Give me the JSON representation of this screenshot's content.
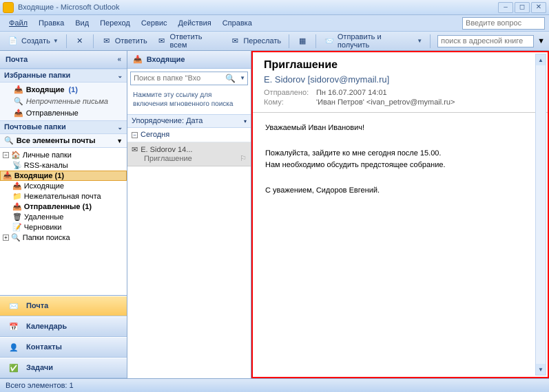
{
  "window": {
    "title": "Входящие - Microsoft Outlook"
  },
  "menu": {
    "file": "Файл",
    "edit": "Правка",
    "view": "Вид",
    "go": "Переход",
    "tools": "Сервис",
    "actions": "Действия",
    "help": "Справка",
    "question_placeholder": "Введите вопрос"
  },
  "toolbar": {
    "create": "Создать",
    "reply": "Ответить",
    "reply_all": "Ответить всем",
    "forward": "Переслать",
    "send_receive": "Отправить и получить",
    "addr_search_placeholder": "поиск в адресной книге"
  },
  "nav": {
    "header": "Почта",
    "favorites_header": "Избранные папки",
    "fav": {
      "inbox": "Входящие",
      "inbox_count": "(1)",
      "unread": "Непрочтенные письма",
      "sent": "Отправленные"
    },
    "mail_folders_header": "Почтовые папки",
    "all_items": "Все элементы почты",
    "tree": {
      "personal": "Личные папки",
      "rss": "RSS-каналы",
      "inbox": "Входящие",
      "inbox_count": "(1)",
      "outbox": "Исходящие",
      "junk": "Нежелательная почта",
      "sent": "Отправленные",
      "sent_count": "(1)",
      "deleted": "Удаленные",
      "drafts": "Черновики",
      "search": "Папки поиска"
    },
    "buttons": {
      "mail": "Почта",
      "calendar": "Календарь",
      "contacts": "Контакты",
      "tasks": "Задачи"
    }
  },
  "msglist": {
    "header": "Входящие",
    "search_placeholder": "Поиск в папке \"Вхо",
    "hint": "Нажмите эту ссылку для включения мгновенного поиска",
    "arrange_label": "Упорядочение:",
    "arrange_by": "Дата",
    "group_today": "Сегодня",
    "msg": {
      "from_time": "E. Sidorov 14...",
      "subject": "Приглашение"
    }
  },
  "reader": {
    "subject": "Приглашение",
    "from": "E. Sidorov [sidorov@mymail.ru]",
    "sent_label": "Отправлено:",
    "sent_value": "Пн 16.07.2007 14:01",
    "to_label": "Кому:",
    "to_value": "'Иван Петров' <ivan_petrov@mymail.ru>",
    "body_l1": "Уважаемый Иван Иванович!",
    "body_l2": "Пожалуйста, зайдите ко мне сегодня после 15.00.",
    "body_l3": "Нам необходимо обсудить предстоящее собрание.",
    "body_l4": "С уважением, Сидоров Евгений."
  },
  "status": {
    "total": "Всего элементов: 1"
  }
}
